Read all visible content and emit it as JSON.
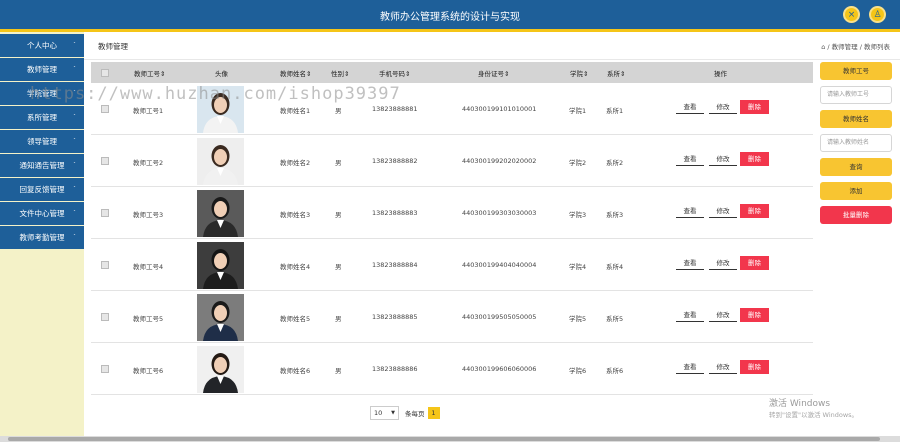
{
  "app": {
    "title": "教师办公管理系统的设计与实现"
  },
  "header": {
    "icon1": "×",
    "icon2": "♙"
  },
  "sidebar": {
    "items": [
      {
        "label": "个人中心"
      },
      {
        "label": "教师管理"
      },
      {
        "label": "学院管理"
      },
      {
        "label": "系所管理"
      },
      {
        "label": "领导管理"
      },
      {
        "label": "通知通告管理"
      },
      {
        "label": "回复反馈管理"
      },
      {
        "label": "文件中心管理"
      },
      {
        "label": "教师考勤管理"
      }
    ]
  },
  "page": {
    "title": "教师管理",
    "breadcrumb": "⌂ / 教师管理 / 教师列表"
  },
  "table": {
    "headers": [
      "教师工号⇕",
      "头像",
      "教师姓名⇕",
      "性别⇕",
      "手机号码⇕",
      "身份证号⇕",
      "学院⇕",
      "系所⇕",
      "操作"
    ],
    "rows": [
      {
        "id": "教师工号1",
        "name": "教师姓名1",
        "gender": "男",
        "phone": "13823888881",
        "idcard": "440300199101010001",
        "college": "学院1",
        "dept": "系所1"
      },
      {
        "id": "教师工号2",
        "name": "教师姓名2",
        "gender": "男",
        "phone": "13823888882",
        "idcard": "440300199202020002",
        "college": "学院2",
        "dept": "系所2"
      },
      {
        "id": "教师工号3",
        "name": "教师姓名3",
        "gender": "男",
        "phone": "13823888883",
        "idcard": "440300199303030003",
        "college": "学院3",
        "dept": "系所3"
      },
      {
        "id": "教师工号4",
        "name": "教师姓名4",
        "gender": "男",
        "phone": "13823888884",
        "idcard": "440300199404040004",
        "college": "学院4",
        "dept": "系所4"
      },
      {
        "id": "教师工号5",
        "name": "教师姓名5",
        "gender": "男",
        "phone": "13823888885",
        "idcard": "440300199505050005",
        "college": "学院5",
        "dept": "系所5"
      },
      {
        "id": "教师工号6",
        "name": "教师姓名6",
        "gender": "男",
        "phone": "13823888886",
        "idcard": "440300199606060006",
        "college": "学院6",
        "dept": "系所6"
      }
    ],
    "actions": {
      "view": "查看",
      "edit": "修改",
      "delete": "删除"
    }
  },
  "pagination": {
    "page_size": "10",
    "label": "条每页",
    "current": "1"
  },
  "search": {
    "id_label": "教师工号",
    "id_placeholder": "请输入教师工号",
    "name_label": "教师姓名",
    "name_placeholder": "请输入教师姓名",
    "query": "查询",
    "add": "添加",
    "batch_delete": "批量删除"
  },
  "overlay": {
    "watermark": "https://www.huzhan.com/ishop39397"
  },
  "windows": {
    "line1": "激活 Windows",
    "line2": "转到\"设置\"以激活 Windows。"
  }
}
